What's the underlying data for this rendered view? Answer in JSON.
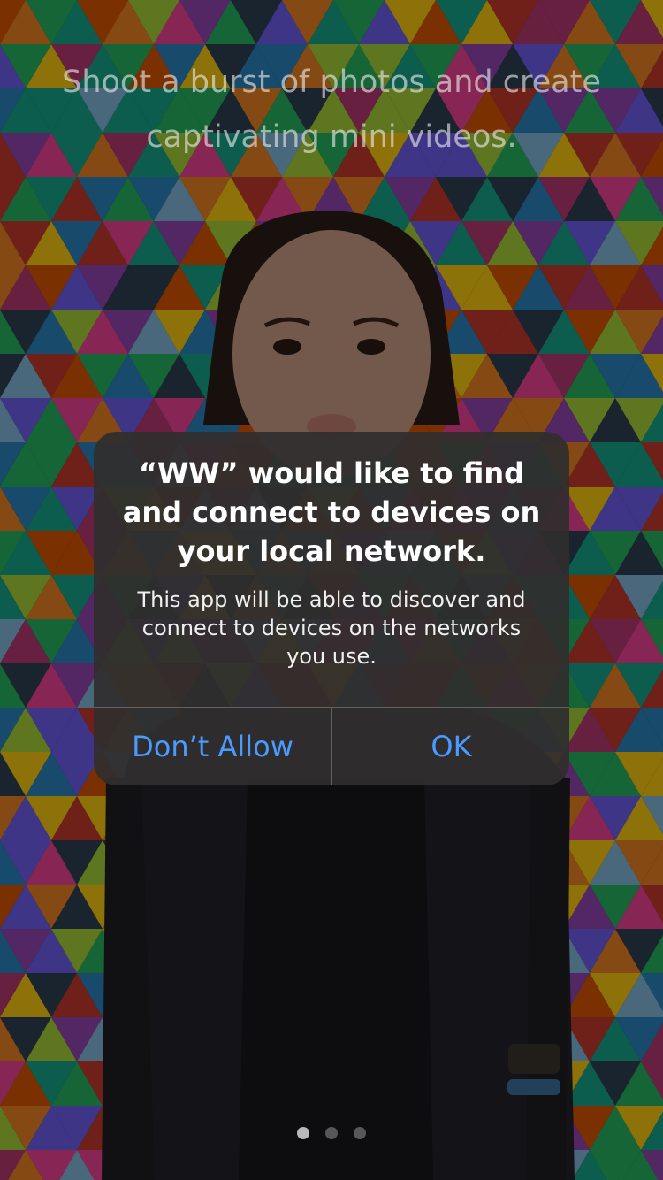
{
  "onboarding": {
    "tagline": "Shoot a burst of photos and create captivating mini videos.",
    "page_count": 3,
    "active_page": 1
  },
  "alert": {
    "title": "“WW” would like to find and connect to devices on your local network.",
    "message": "This app will be able to discover and connect to devices on the networks you use.",
    "buttons": {
      "deny": "Don’t Allow",
      "ok": "OK"
    },
    "accent_color": "#4a9bff"
  }
}
